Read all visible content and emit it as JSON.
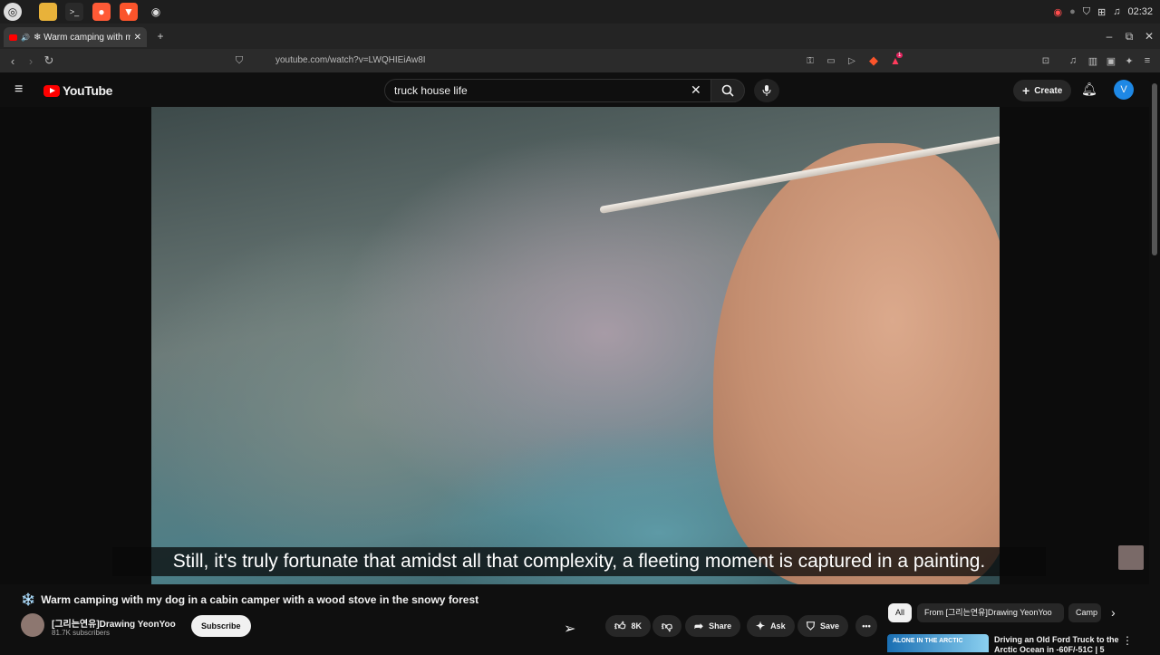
{
  "taskbar": {
    "clock": "02:32"
  },
  "browser": {
    "tab_title": "❄ Warm camping with my",
    "url": "youtube.com/watch?v=LWQHIEiAw8I",
    "new_tab": "+",
    "badge_count": "1"
  },
  "youtube": {
    "logo_text": "YouTube",
    "search_query": "truck house life",
    "create_label": "Create",
    "avatar_letter": "V"
  },
  "video": {
    "subtitle": "Still, it's truly fortunate that amidst all that complexity, a fleeting moment is captured in a painting.",
    "title_emoji": "❄️",
    "title": "Warm camping with my dog in a cabin camper with a wood stove in the snowy forest",
    "channel_name": "[그리는연유]Drawing YeonYoo",
    "subscribers": "81.7K subscribers",
    "subscribe_label": "Subscribe",
    "likes": "8K",
    "share_label": "Share",
    "ask_label": "Ask",
    "save_label": "Save"
  },
  "sidebar": {
    "chips": [
      "All",
      "From [그리는연유]Drawing YeonYoo",
      "Camp"
    ],
    "rec_thumb_text": "ALONE IN THE ARCTIC",
    "rec_title": "Driving an Old Ford Truck to the Arctic Ocean in -60F/-51C | 5"
  },
  "colors": {
    "accent": "#ff0000",
    "avatar": "#1e88e5",
    "background": "#0f0f0f"
  }
}
